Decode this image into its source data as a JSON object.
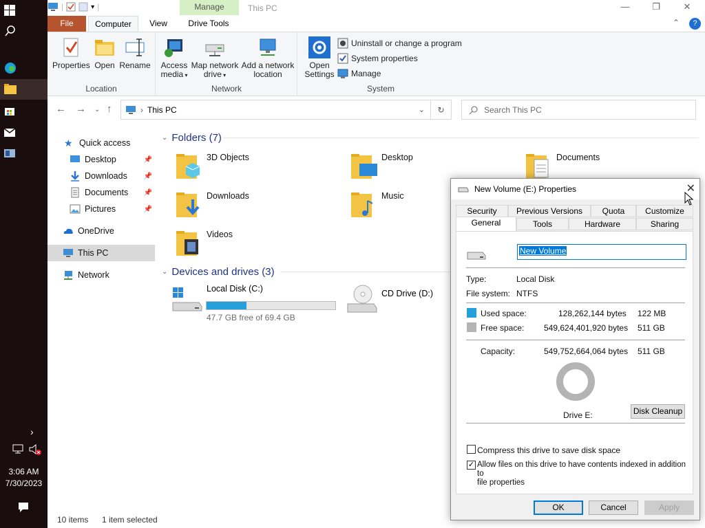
{
  "taskbar": {
    "time": "3:06 AM",
    "date": "7/30/2023"
  },
  "window": {
    "context_tab": "Manage",
    "title": "This PC"
  },
  "ribbon_tabs": {
    "file": "File",
    "computer": "Computer",
    "view": "View",
    "drive_tools": "Drive Tools"
  },
  "ribbon": {
    "location": {
      "label": "Location",
      "properties": "Properties",
      "open": "Open",
      "rename": "Rename"
    },
    "network": {
      "label": "Network",
      "access_media_1": "Access",
      "access_media_2": "media",
      "map_drive_1": "Map network",
      "map_drive_2": "drive",
      "add_location_1": "Add a network",
      "add_location_2": "location"
    },
    "system": {
      "label": "System",
      "open_settings_1": "Open",
      "open_settings_2": "Settings",
      "uninstall": "Uninstall or change a program",
      "system_properties": "System properties",
      "manage": "Manage"
    }
  },
  "address": {
    "path": "This PC",
    "search_placeholder": "Search This PC"
  },
  "nav": {
    "quick_access": "Quick access",
    "desktop": "Desktop",
    "downloads": "Downloads",
    "documents": "Documents",
    "pictures": "Pictures",
    "onedrive": "OneDrive",
    "this_pc": "This PC",
    "network": "Network"
  },
  "folders": {
    "heading": "Folders (7)",
    "items": [
      "3D Objects",
      "Desktop",
      "Documents",
      "Downloads",
      "Music",
      "Videos"
    ]
  },
  "drives": {
    "heading": "Devices and drives (3)",
    "c_name": "Local Disk (C:)",
    "c_free": "47.7 GB free of 69.4 GB",
    "c_used_fraction": 0.31,
    "d_name": "CD Drive (D:)"
  },
  "status": {
    "items": "10 items",
    "selected": "1 item selected"
  },
  "dialog": {
    "title": "New Volume (E:) Properties",
    "tabs_top": [
      "Security",
      "Previous Versions",
      "Quota",
      "Customize"
    ],
    "tabs_bottom": [
      "General",
      "Tools",
      "Hardware",
      "Sharing"
    ],
    "volume_name": "New Volume",
    "type_label": "Type:",
    "type_value": "Local Disk",
    "fs_label": "File system:",
    "fs_value": "NTFS",
    "used_label": "Used space:",
    "used_bytes": "128,262,144 bytes",
    "used_size": "122 MB",
    "free_label": "Free space:",
    "free_bytes": "549,624,401,920 bytes",
    "free_size": "511 GB",
    "capacity_label": "Capacity:",
    "capacity_bytes": "549,752,664,064 bytes",
    "capacity_size": "511 GB",
    "drive_label": "Drive E:",
    "disk_cleanup": "Disk Cleanup",
    "compress": "Compress this drive to save disk space",
    "index_1": "Allow files on this drive to have contents indexed in addition to",
    "index_2": "file properties",
    "ok": "OK",
    "cancel": "Cancel",
    "apply": "Apply",
    "used_color": "#26a0da",
    "free_color": "#b4b4b4"
  }
}
